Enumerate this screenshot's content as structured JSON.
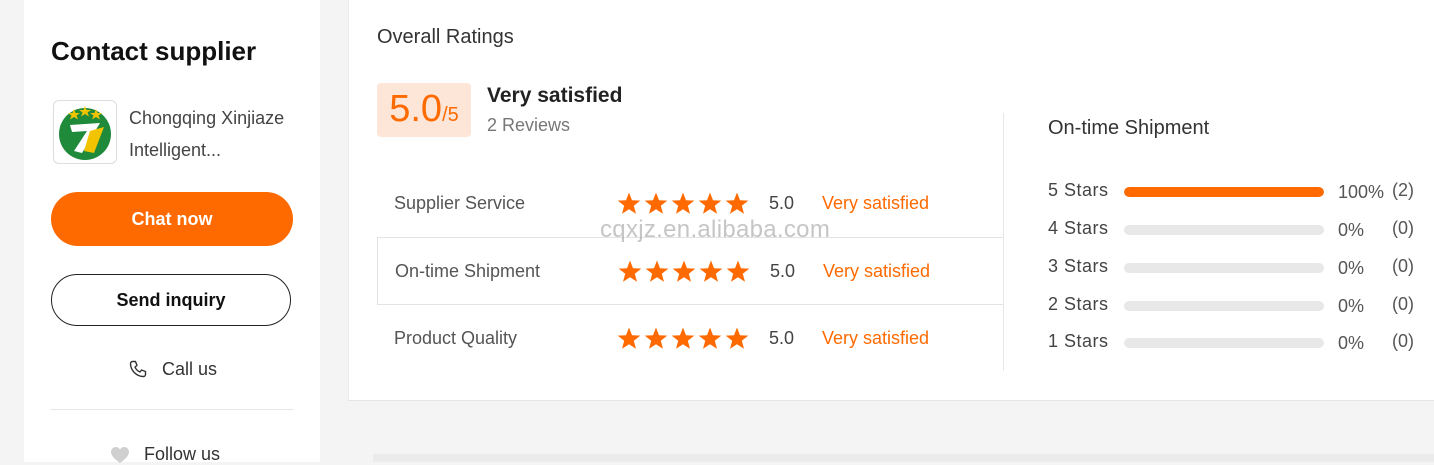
{
  "sidebar": {
    "title": "Contact supplier",
    "supplier_name_line1": "Chongqing Xinjiaze",
    "supplier_name_line2": "Intelligent...",
    "chat_label": "Chat now",
    "inquiry_label": "Send inquiry",
    "call_label": "Call us",
    "follow_label": "Follow us",
    "logo_icon": "company-logo"
  },
  "overall": {
    "title": "Overall Ratings",
    "score": "5.0",
    "max": "/5",
    "summary": "Very satisfied",
    "reviews": "2 Reviews"
  },
  "ratings": [
    {
      "label": "Supplier Service",
      "stars": 5,
      "score": "5.0",
      "text": "Very satisfied"
    },
    {
      "label": "On-time Shipment",
      "stars": 5,
      "score": "5.0",
      "text": "Very satisfied"
    },
    {
      "label": "Product Quality",
      "stars": 5,
      "score": "5.0",
      "text": "Very satisfied"
    }
  ],
  "distribution": {
    "title": "On-time Shipment",
    "rows": [
      {
        "label": "5  Stars",
        "fraction": 1.0,
        "pct": "100%",
        "count": "(2)"
      },
      {
        "label": "4  Stars",
        "fraction": 0.0,
        "pct": "0%",
        "count": "(0)"
      },
      {
        "label": "3  Stars",
        "fraction": 0.0,
        "pct": "0%",
        "count": "(0)"
      },
      {
        "label": "2  Stars",
        "fraction": 0.0,
        "pct": "0%",
        "count": "(0)"
      },
      {
        "label": "1  Stars",
        "fraction": 0.0,
        "pct": "0%",
        "count": "(0)"
      }
    ]
  },
  "watermark": "cqxjz.en.alibaba.com",
  "colors": {
    "accent": "#ff6a00",
    "accent_light": "#fde6d8",
    "bar_track": "#e8e8e8"
  }
}
